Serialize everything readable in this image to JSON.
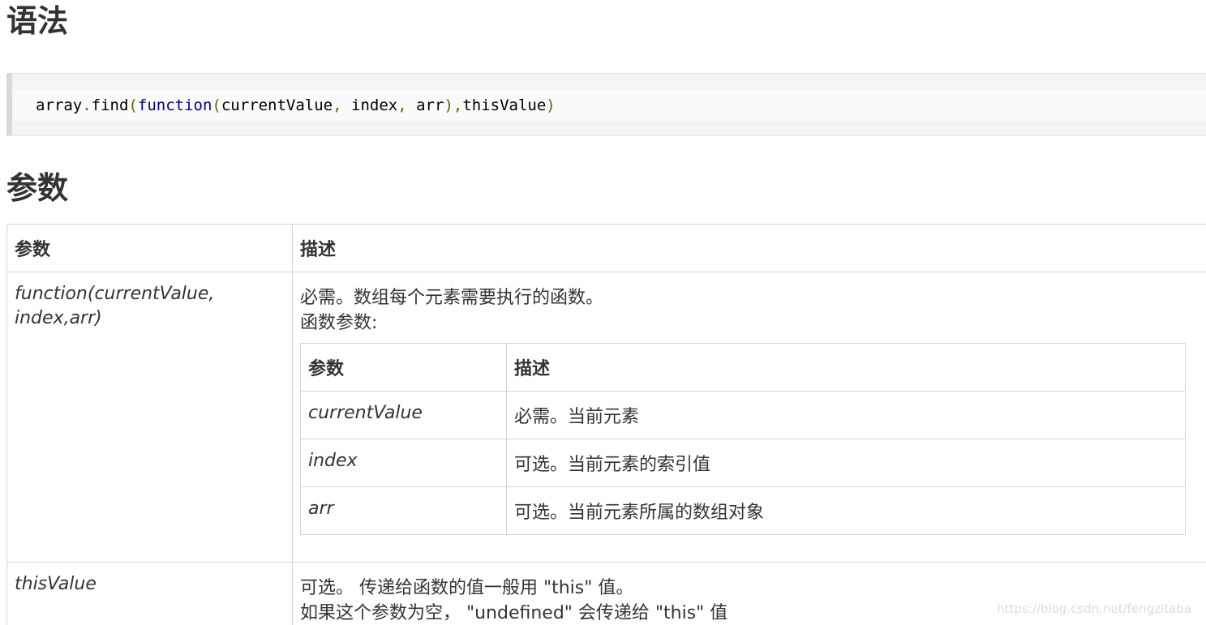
{
  "headings": {
    "syntax": "语法",
    "params": "参数"
  },
  "code": {
    "tokens": [
      "array",
      ".",
      "find",
      "(",
      "function",
      "(",
      "currentValue",
      ",",
      " index",
      ",",
      " arr",
      ")",
      ",",
      "thisValue",
      ")"
    ]
  },
  "table": {
    "headers": [
      "参数",
      "描述"
    ],
    "rows": [
      {
        "name": "function(currentValue, index,arr)",
        "desc_lines": [
          "必需。数组每个元素需要执行的函数。",
          "函数参数:"
        ],
        "sub": {
          "headers": [
            "参数",
            "描述"
          ],
          "rows": [
            {
              "name": "currentValue",
              "desc": "必需。当前元素"
            },
            {
              "name": "index",
              "desc": "可选。当前元素的索引值"
            },
            {
              "name": "arr",
              "desc": "可选。当前元素所属的数组对象"
            }
          ]
        }
      },
      {
        "name": "thisValue",
        "desc_lines": [
          "可选。 传递给函数的值一般用 \"this\" 值。",
          "如果这个参数为空， \"undefined\" 会传递给 \"this\" 值"
        ]
      }
    ]
  },
  "watermark": "https://blog.csdn.net/fengzitaba"
}
